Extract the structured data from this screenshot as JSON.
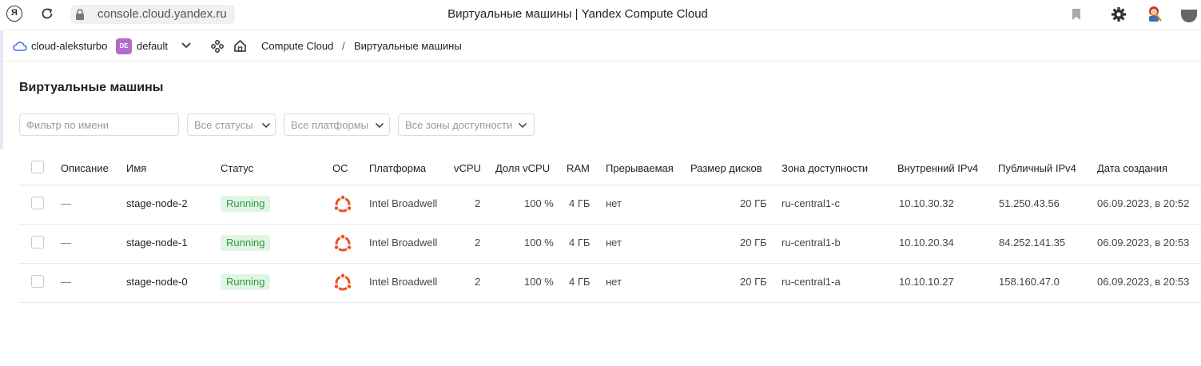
{
  "browser": {
    "logo_letter": "Я",
    "url": "console.cloud.yandex.ru",
    "window_title": "Виртуальные машины | Yandex Compute Cloud"
  },
  "nav": {
    "cloud_name": "cloud-aleksturbo",
    "folder_badge": "DE",
    "folder_name": "default",
    "breadcrumb": [
      "Compute Cloud",
      "Виртуальные машины"
    ],
    "breadcrumb_separator": "/"
  },
  "page": {
    "title": "Виртуальные машины"
  },
  "filters": {
    "name_placeholder": "Фильтр по имени",
    "status": "Все статусы",
    "platform": "Все платформы",
    "zone": "Все зоны доступности"
  },
  "table": {
    "columns": [
      "Описание",
      "Имя",
      "Статус",
      "ОС",
      "Платформа",
      "vCPU",
      "Доля vCPU",
      "RAM",
      "Прерываемая",
      "Размер дисков",
      "Зона доступности",
      "Внутренний IPv4",
      "Публичный IPv4",
      "Дата создания"
    ],
    "rows": [
      {
        "description": "—",
        "name": "stage-node-2",
        "status": "Running",
        "os": "ubuntu-icon",
        "platform": "Intel Broadwell",
        "vcpu": "2",
        "vcpu_share": "100 %",
        "ram": "4 ГБ",
        "preemptible": "нет",
        "disk_size": "20 ГБ",
        "zone": "ru-central1-c",
        "internal_ip": "10.10.30.32",
        "public_ip": "51.250.43.56",
        "created": "06.09.2023, в 20:52"
      },
      {
        "description": "—",
        "name": "stage-node-1",
        "status": "Running",
        "os": "ubuntu-icon",
        "platform": "Intel Broadwell",
        "vcpu": "2",
        "vcpu_share": "100 %",
        "ram": "4 ГБ",
        "preemptible": "нет",
        "disk_size": "20 ГБ",
        "zone": "ru-central1-b",
        "internal_ip": "10.10.20.34",
        "public_ip": "84.252.141.35",
        "created": "06.09.2023, в 20:53"
      },
      {
        "description": "—",
        "name": "stage-node-0",
        "status": "Running",
        "os": "ubuntu-icon",
        "platform": "Intel Broadwell",
        "vcpu": "2",
        "vcpu_share": "100 %",
        "ram": "4 ГБ",
        "preemptible": "нет",
        "disk_size": "20 ГБ",
        "zone": "ru-central1-a",
        "internal_ip": "10.10.10.27",
        "public_ip": "158.160.47.0",
        "created": "06.09.2023, в 20:53"
      }
    ]
  },
  "colors": {
    "status_running_bg": "#e2f5e5",
    "status_running_text": "#2a9c3f",
    "ubuntu_orange": "#e95420",
    "folder_badge": "#b36ccb",
    "cloud_icon": "#3f6ee0"
  }
}
